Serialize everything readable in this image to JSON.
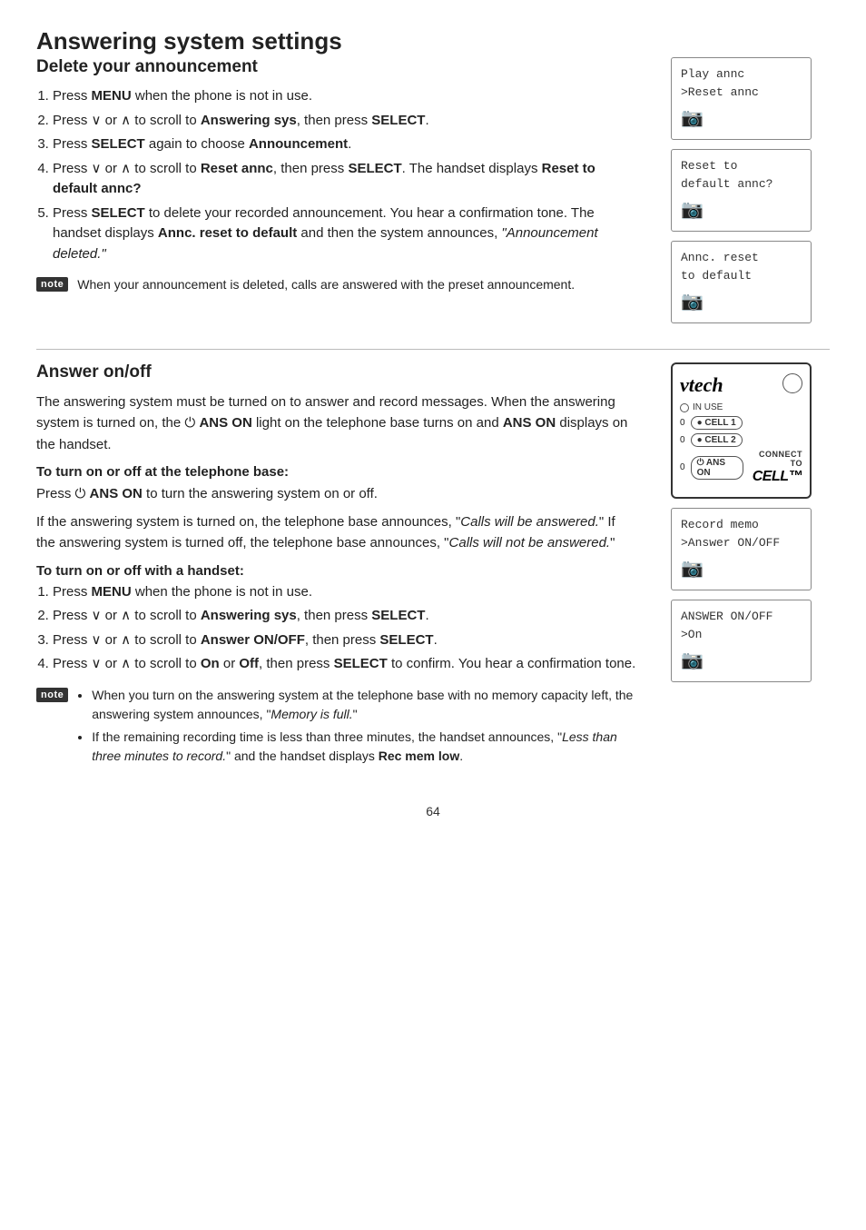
{
  "page": {
    "title": "Answering system settings",
    "page_number": "64",
    "section1": {
      "title": "Delete your announcement",
      "steps": [
        "Press <b>MENU</b> when the phone is not in use.",
        "Press ∨ or ∧ to scroll to <b>Answering sys</b>, then press <b>SELECT</b>.",
        "Press <b>SELECT</b> again to choose <b>Announcement</b>.",
        "Press ∨ or ∧ to scroll to <b>Reset annc</b>, then press <b>SELECT</b>. The handset displays <b>Reset to default annc?</b>",
        "Press <b>SELECT</b> to delete your recorded announcement. You hear a confirmation tone. The handset displays <b>Annc. reset to default</b> and then the system announces, <i>\"Announcement deleted.\"</i>"
      ],
      "note": "When your announcement is deleted, calls are answered with the preset announcement.",
      "lcd_screens": [
        {
          "line1": "Play annc",
          "line2": ">Reset annc",
          "has_icon": true
        },
        {
          "line1": "Reset to",
          "line2": "default annc?",
          "has_icon": true
        },
        {
          "line1": "Annc. reset",
          "line2": "to default",
          "has_icon": true
        }
      ]
    },
    "section2": {
      "title": "Answer on/off",
      "intro_text1": "The answering system must be turned on to answer and record messages. When the answering system is turned on, the ⏻ ANS ON light on the telephone base turns on and ANS ON displays on the handset.",
      "subsection1": {
        "title": "To turn on or off at the telephone base:",
        "text": "Press ⏻ ANS ON to turn the answering system on or off.",
        "text2_part1": "If the answering system is turned on, the telephone base announces, \"",
        "text2_italic": "Calls will be answered.",
        "text2_part2": "\" If the answering system is turned off, the telephone base announces, \"",
        "text2_italic2": "Calls will not be answered.",
        "text2_end": "\""
      },
      "subsection2": {
        "title": "To turn on or off with a handset:",
        "steps": [
          "Press <b>MENU</b> when the phone is not in use.",
          "Press ∨ or ∧ to scroll to <b>Answering sys</b>, then press <b>SELECT</b>.",
          "Press ∨ or ∧ to scroll to <b>Answer ON/OFF</b>, then press <b>SELECT</b>.",
          "Press ∨ or ∧ to scroll to <b>On</b> or <b>Off</b>, then press <b>SELECT</b> to confirm. You hear a confirmation tone."
        ]
      },
      "notes": [
        "When you turn on the answering system at the telephone base with no memory capacity left, the answering system announces, \"<i>Memory is full.</i>\"",
        "If the remaining recording time is less than three minutes, the handset announces, \"<i>Less than three minutes to record.</i>\" and the handset displays <b>Rec mem low</b>."
      ],
      "phone_base": {
        "brand": "vtech",
        "indicators": [
          {
            "label": "IN USE",
            "type": "dot_circle"
          },
          {
            "label": "CELL 1",
            "type": "oval_0"
          },
          {
            "label": "CELL 2",
            "type": "oval_0"
          },
          {
            "label": "ANS ON",
            "type": "oval_0",
            "has_connect": true
          }
        ]
      },
      "lcd_screens2": [
        {
          "line1": "Record memo",
          "line2": ">Answer ON/OFF",
          "has_icon": true
        },
        {
          "line1": "ANSWER ON/OFF",
          "line2": ">On",
          "has_icon": true
        }
      ]
    }
  }
}
